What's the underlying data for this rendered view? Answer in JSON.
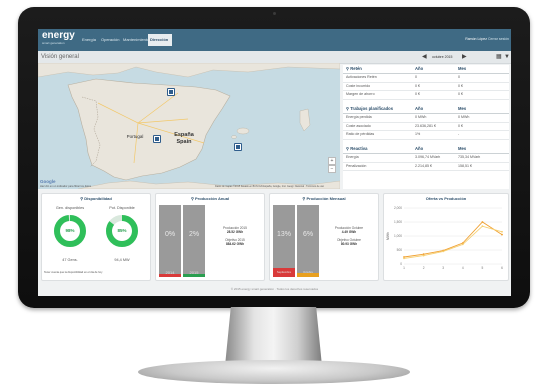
{
  "app": {
    "logo": "energy",
    "logo_sub": "smart generation",
    "nav": [
      "Energía",
      "Operación",
      "Mantenimiento",
      "Dirección"
    ],
    "active_nav": "Dirección",
    "user": "Ramón López",
    "logout": "Cerrar sesión"
  },
  "subheader": {
    "title": "Visión general",
    "date": "octubre 2015",
    "prev_icon": "circle-chevron-left",
    "next_icon": "circle-chevron-right",
    "calendar_icon": "calendar",
    "filter_icon": "filter"
  },
  "map": {
    "labels": {
      "portugal": "Portugal",
      "espana": "España",
      "spain": "Spain"
    },
    "google": "Google",
    "hint": "Haz clic en un indicador para filtrar los datos",
    "attribution": "Datos de mapas ©2015 basado en BCN IGN España, Google, Inst. Geogr. Nacional · Términos de uso",
    "zoom_in": "+",
    "zoom_out": "−"
  },
  "tables": {
    "retenes": {
      "title": "Retén",
      "col_year": "Año",
      "col_month": "Mes",
      "rows": [
        {
          "label": "Activaciones Retén",
          "year": "0",
          "month": "0"
        },
        {
          "label": "Coste incurrido",
          "year": "0 €",
          "month": "0 €"
        },
        {
          "label": "Margen de ahorro",
          "year": "0 €",
          "month": "0 €"
        }
      ]
    },
    "trabajos": {
      "title": "Trabajos planificados",
      "col_year": "Año",
      "col_month": "Mes",
      "rows": [
        {
          "label": "Energía perdida",
          "year": "0 MWh",
          "month": "0 MWh"
        },
        {
          "label": "Coste asociado",
          "year": "23.636,281 €",
          "month": "0 €"
        },
        {
          "label": "Ratio de pérdidas",
          "year": "1%",
          "month": "-"
        }
      ]
    },
    "reactiva": {
      "title": "Reactiva",
      "col_year": "Año",
      "col_month": "Mes",
      "rows": [
        {
          "label": "Energía",
          "year": "3.096,74 MVarh",
          "month": "735,34 MVarh"
        },
        {
          "label": "Penalización",
          "year": "2.214,85 €",
          "month": "158,51 €"
        }
      ]
    }
  },
  "disponibilidad": {
    "title": "Disponibilidad",
    "gen_label": "Gen. disponibles",
    "pot_label": "Pot. Disponible",
    "gen_pct": "98%",
    "pot_pct": "85%",
    "gen_fraction": 0.98,
    "pot_fraction": 0.85,
    "gen_value": "47 Gens.",
    "pot_value": "94,4 MW",
    "note": "Tener cuenta que la disponibilidad en el día de hoy"
  },
  "produccion_anual": {
    "title": "Producción Anual",
    "bars": [
      {
        "pct": "0%",
        "year": "2014",
        "fraction": 0.0
      },
      {
        "pct": "2%",
        "year": "2015",
        "fraction": 0.02
      }
    ],
    "line1_label": "Producción 2015",
    "line1_value": "28.52 GWh",
    "line2_label": "Objetivo 2015",
    "line2_value": "884.62 GWh"
  },
  "produccion_mensual": {
    "title": "Producción Mensual",
    "bars": [
      {
        "pct": "13%",
        "year": "Septiembre",
        "fraction": 0.13
      },
      {
        "pct": "6%",
        "year": "Octubre",
        "fraction": 0.06
      }
    ],
    "line1_label": "Producción Octubre",
    "line1_value": "4.49 GWh",
    "line2_label": "Objetivo Octubre",
    "line2_value": "80.93 GWh"
  },
  "chart_data": {
    "type": "line",
    "title": "Oferta vs Producción",
    "ylabel": "MWh",
    "x": [
      1,
      2,
      3,
      4,
      5,
      6
    ],
    "ylim": [
      0,
      2000
    ],
    "yticks": [
      "0",
      "500",
      "1,000",
      "1,500",
      "2,000"
    ],
    "series": [
      {
        "values": [
          250,
          350,
          480,
          750,
          1500,
          1050
        ],
        "color": "#f0a030"
      },
      {
        "values": [
          200,
          300,
          450,
          700,
          1350,
          1150
        ],
        "color": "#f6cf70"
      }
    ]
  },
  "footer": "© 2015 energy smart generation · Todos los derechos reservados"
}
